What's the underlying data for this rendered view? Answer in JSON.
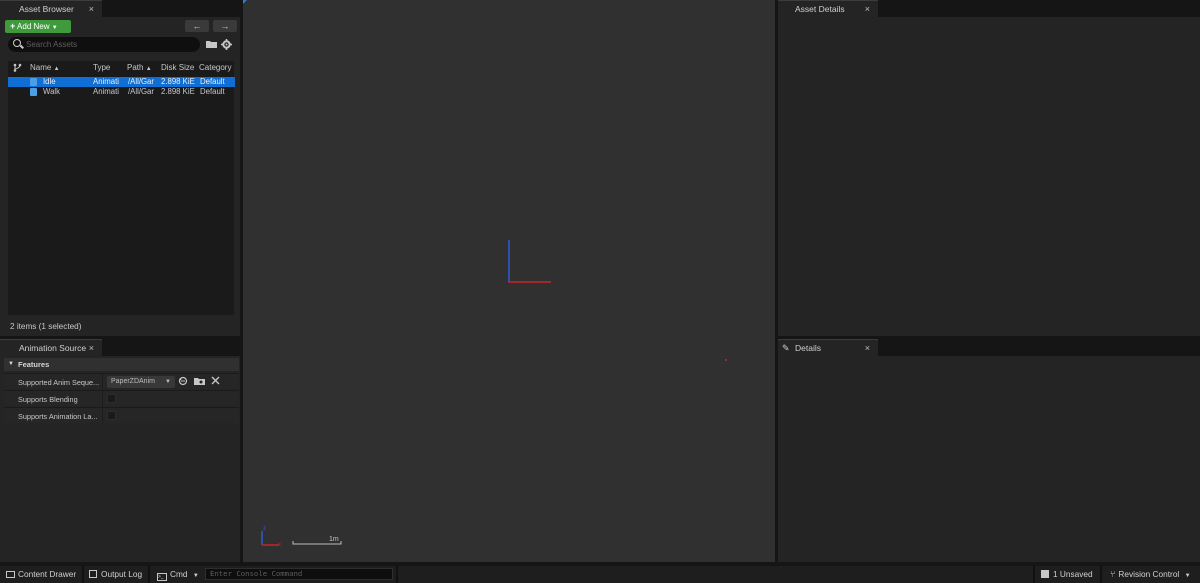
{
  "asset_browser": {
    "tab_label": "Asset Browser",
    "close_glyph": "×",
    "add_new_label": "Add New",
    "search_placeholder": "Search Assets",
    "columns": [
      "Name",
      "Type",
      "Path",
      "Disk Size",
      "Category"
    ],
    "rows": [
      {
        "name": "Idle",
        "type": "Animati",
        "path": "/All/Gar",
        "size": "2.898 KiE",
        "category": "Default",
        "selected": true
      },
      {
        "name": "Walk",
        "type": "Animati",
        "path": "/All/Gar",
        "size": "2.898 KiE",
        "category": "Default",
        "selected": false
      }
    ],
    "status": "2 items (1 selected)"
  },
  "animation_source": {
    "tab_label": "Animation Source",
    "section": "Features",
    "props": [
      {
        "label": "Supported Anim Seque...",
        "value": "PaperZDAnim"
      },
      {
        "label": "Supports Blending"
      },
      {
        "label": "Supports Animation La..."
      }
    ]
  },
  "viewport": {
    "scale_label": "1m",
    "axis_z": "z",
    "axis_x": "x",
    "colors": {
      "x_axis": "#c8242a",
      "z_axis": "#2e5bd6",
      "point": "#d02020"
    }
  },
  "asset_details": {
    "tab_label": "Asset Details"
  },
  "details": {
    "tab_label": "Details"
  },
  "bottom_bar": {
    "content_drawer": "Content Drawer",
    "output_log": "Output Log",
    "cmd": "Cmd",
    "console_placeholder": "Enter Console Command",
    "unsaved": "1 Unsaved",
    "revision_control": "Revision Control"
  },
  "icons": [
    "plus-icon",
    "chevron-down-icon",
    "arrow-left-icon",
    "arrow-right-icon",
    "search-icon",
    "folder-icon",
    "gear-icon",
    "source-control-icon",
    "file-icon",
    "sort-up-icon",
    "pencil-icon",
    "reset-icon",
    "browse-icon",
    "clear-icon",
    "terminal-icon",
    "save-icon"
  ]
}
